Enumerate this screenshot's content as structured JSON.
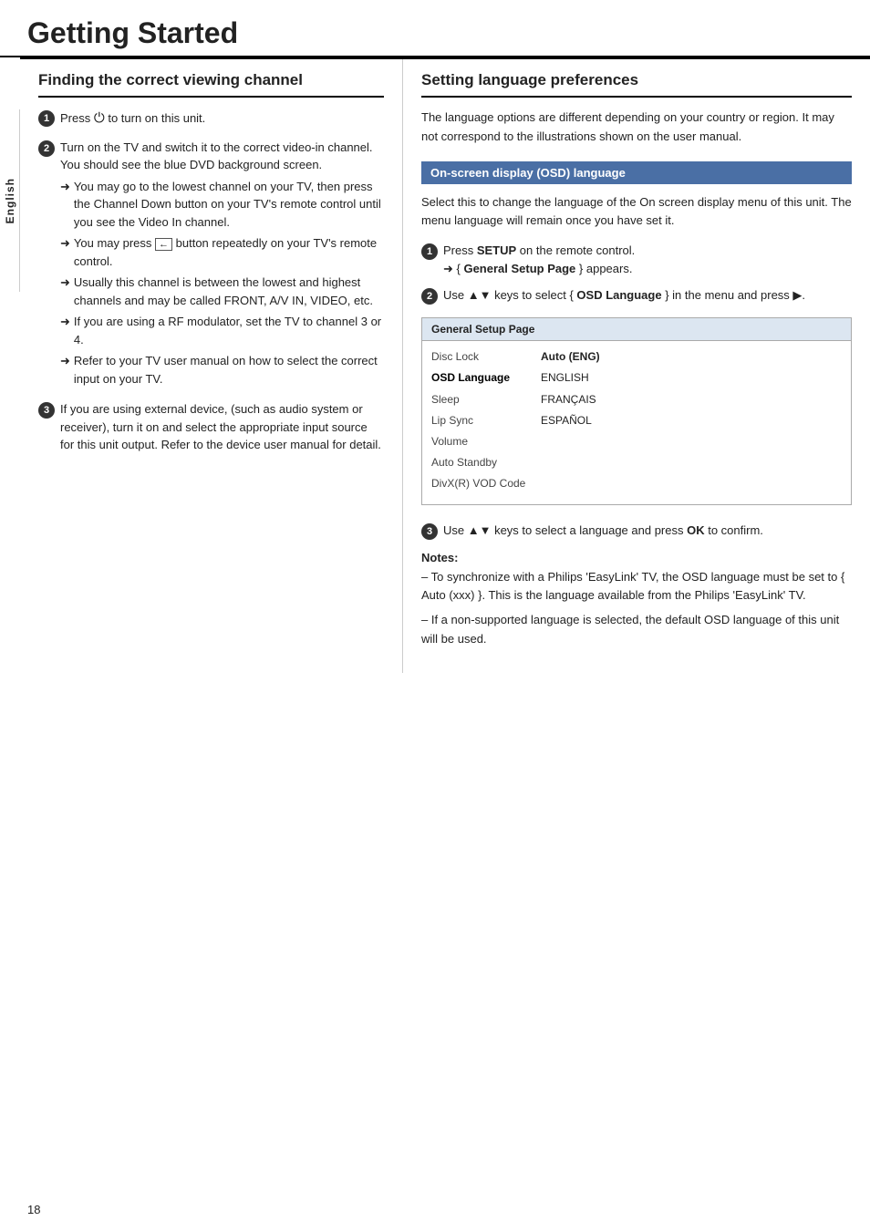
{
  "page": {
    "title": "Getting Started",
    "number": "18",
    "sidebar_label": "English"
  },
  "left_section": {
    "heading": "Finding the correct viewing channel",
    "steps": [
      {
        "number": "1",
        "text": "Press  to turn on this unit."
      },
      {
        "number": "2",
        "text": "Turn on the TV and switch it to the correct video-in channel. You should see the blue DVD background screen.",
        "arrows": [
          "You may go to the lowest channel on your TV, then press the Channel Down button on your TV's remote control until you see the Video In channel.",
          "You may press  button repeatedly on your TV's remote control.",
          "Usually this channel is between the lowest and highest channels and may be called FRONT, A/V IN, VIDEO, etc.",
          "If you are using a RF modulator, set the TV to channel 3 or 4.",
          "Refer to your TV user manual on how to select the correct input on your TV."
        ]
      },
      {
        "number": "3",
        "text": "If you are using external device, (such as audio system or receiver), turn it on and select the appropriate input source for this unit output. Refer to the device user manual for detail."
      }
    ]
  },
  "right_section": {
    "heading": "Setting language preferences",
    "intro": "The language options are different depending on your country or region. It may not correspond to the illustrations shown on the user manual.",
    "osd_box_label": "On-screen display (OSD) language",
    "osd_description": "Select this to change the language of the On screen display menu of this unit. The menu language will remain once you have set it.",
    "steps": [
      {
        "number": "1",
        "text": "Press SETUP on the remote control.",
        "sub": "→ { General Setup Page } appears."
      },
      {
        "number": "2",
        "text": "Use ▲▼ keys to select { OSD Language } in the menu and press ▶."
      }
    ],
    "setup_table": {
      "header": "General Setup Page",
      "left_items": [
        {
          "label": "Disc Lock",
          "selected": false
        },
        {
          "label": "OSD Language",
          "selected": true
        },
        {
          "label": "Sleep",
          "selected": false
        },
        {
          "label": "Lip Sync",
          "selected": false
        },
        {
          "label": "Volume",
          "selected": false
        },
        {
          "label": "Auto Standby",
          "selected": false
        },
        {
          "label": "DivX(R) VOD Code",
          "selected": false
        }
      ],
      "right_items": [
        {
          "label": "Auto (ENG)",
          "selected": true
        },
        {
          "label": "ENGLISH",
          "selected": false
        },
        {
          "label": "FRANÇAIS",
          "selected": false
        },
        {
          "label": "ESPAÑOL",
          "selected": false
        }
      ]
    },
    "step3": {
      "number": "3",
      "text": "Use ▲▼ keys to select a language and press OK to confirm."
    },
    "notes": {
      "title": "Notes:",
      "items": [
        "– To synchronize with a Philips 'EasyLink' TV, the OSD language must be set to { Auto (xxx) }. This is the language available from the Philips 'EasyLink' TV.",
        "– If a non-supported language is selected, the default OSD language of this unit will be used."
      ]
    }
  }
}
